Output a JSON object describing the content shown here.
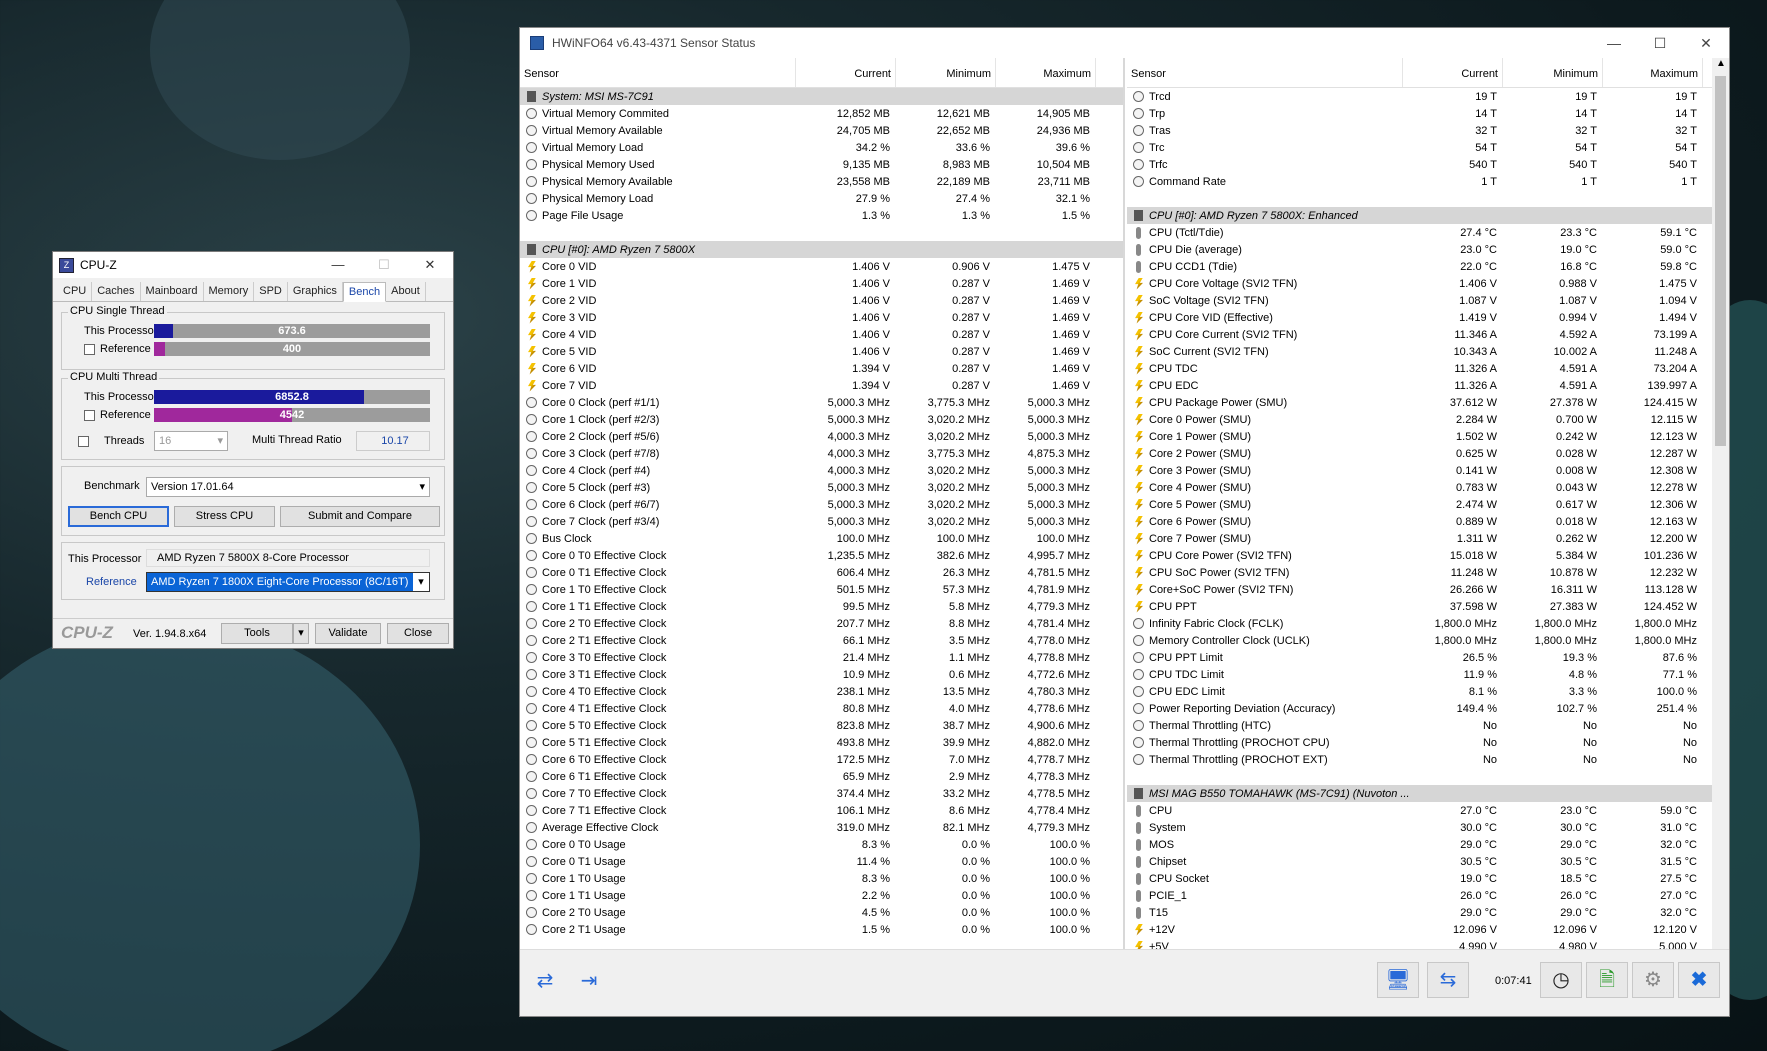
{
  "cpuz": {
    "title": "CPU-Z",
    "tabs": [
      "CPU",
      "Caches",
      "Mainboard",
      "Memory",
      "SPD",
      "Graphics",
      "Bench",
      "About"
    ],
    "active_tab": "Bench",
    "single_thread_label": "CPU Single Thread",
    "multi_thread_label": "CPU Multi Thread",
    "this_processor_label": "This Processor",
    "reference_label": "Reference",
    "single_this_value": "673.6",
    "single_this_fraction": 0.07,
    "single_ref_value": "400",
    "single_ref_fraction": 0.04,
    "multi_this_value": "6852.8",
    "multi_this_fraction": 0.76,
    "multi_ref_value": "4542",
    "multi_ref_fraction": 0.5,
    "threads_label": "Threads",
    "threads_value": "16",
    "mt_ratio_label": "Multi Thread Ratio",
    "mt_ratio_value": "10.17",
    "benchmark_label": "Benchmark",
    "benchmark_value": "Version 17.01.64",
    "bench_cpu": "Bench CPU",
    "stress_cpu": "Stress CPU",
    "submit": "Submit and Compare",
    "this_processor_name": "AMD Ryzen 7 5800X 8-Core Processor",
    "reference_name": "AMD Ryzen 7 1800X Eight-Core Processor (8C/16T)",
    "logo": "CPU-Z",
    "version": "Ver. 1.94.8.x64",
    "tools": "Tools",
    "validate": "Validate",
    "close": "Close",
    "colors": {
      "this_bar": "#1a1a9c",
      "ref_bar": "#a0289c"
    }
  },
  "hwinfo": {
    "title": "HWiNFO64 v6.43-4371 Sensor Status",
    "columns": [
      "Sensor",
      "Current",
      "Minimum",
      "Maximum"
    ],
    "time": "0:07:41",
    "left_rows": [
      {
        "t": "group",
        "n": "System: MSI MS-7C91"
      },
      {
        "t": "clock",
        "n": "Virtual Memory Commited",
        "c": "12,852 MB",
        "mi": "12,621 MB",
        "ma": "14,905 MB"
      },
      {
        "t": "clock",
        "n": "Virtual Memory Available",
        "c": "24,705 MB",
        "mi": "22,652 MB",
        "ma": "24,936 MB"
      },
      {
        "t": "clock",
        "n": "Virtual Memory Load",
        "c": "34.2 %",
        "mi": "33.6 %",
        "ma": "39.6 %"
      },
      {
        "t": "clock",
        "n": "Physical Memory Used",
        "c": "9,135 MB",
        "mi": "8,983 MB",
        "ma": "10,504 MB"
      },
      {
        "t": "clock",
        "n": "Physical Memory Available",
        "c": "23,558 MB",
        "mi": "22,189 MB",
        "ma": "23,711 MB"
      },
      {
        "t": "clock",
        "n": "Physical Memory Load",
        "c": "27.9 %",
        "mi": "27.4 %",
        "ma": "32.1 %"
      },
      {
        "t": "clock",
        "n": "Page File Usage",
        "c": "1.3 %",
        "mi": "1.3 %",
        "ma": "1.5 %"
      },
      {
        "t": "blank",
        "n": ""
      },
      {
        "t": "group",
        "n": "CPU [#0]: AMD Ryzen 7 5800X"
      },
      {
        "t": "volt",
        "n": "Core 0 VID",
        "c": "1.406 V",
        "mi": "0.906 V",
        "ma": "1.475 V"
      },
      {
        "t": "volt",
        "n": "Core 1 VID",
        "c": "1.406 V",
        "mi": "0.287 V",
        "ma": "1.469 V"
      },
      {
        "t": "volt",
        "n": "Core 2 VID",
        "c": "1.406 V",
        "mi": "0.287 V",
        "ma": "1.469 V"
      },
      {
        "t": "volt",
        "n": "Core 3 VID",
        "c": "1.406 V",
        "mi": "0.287 V",
        "ma": "1.469 V"
      },
      {
        "t": "volt",
        "n": "Core 4 VID",
        "c": "1.406 V",
        "mi": "0.287 V",
        "ma": "1.469 V"
      },
      {
        "t": "volt",
        "n": "Core 5 VID",
        "c": "1.406 V",
        "mi": "0.287 V",
        "ma": "1.469 V"
      },
      {
        "t": "volt",
        "n": "Core 6 VID",
        "c": "1.394 V",
        "mi": "0.287 V",
        "ma": "1.469 V"
      },
      {
        "t": "volt",
        "n": "Core 7 VID",
        "c": "1.394 V",
        "mi": "0.287 V",
        "ma": "1.469 V"
      },
      {
        "t": "clock",
        "n": "Core 0 Clock (perf #1/1)",
        "c": "5,000.3 MHz",
        "mi": "3,775.3 MHz",
        "ma": "5,000.3 MHz"
      },
      {
        "t": "clock",
        "n": "Core 1 Clock (perf #2/3)",
        "c": "5,000.3 MHz",
        "mi": "3,020.2 MHz",
        "ma": "5,000.3 MHz"
      },
      {
        "t": "clock",
        "n": "Core 2 Clock (perf #5/6)",
        "c": "4,000.3 MHz",
        "mi": "3,020.2 MHz",
        "ma": "5,000.3 MHz"
      },
      {
        "t": "clock",
        "n": "Core 3 Clock (perf #7/8)",
        "c": "4,000.3 MHz",
        "mi": "3,775.3 MHz",
        "ma": "4,875.3 MHz"
      },
      {
        "t": "clock",
        "n": "Core 4 Clock (perf #4)",
        "c": "4,000.3 MHz",
        "mi": "3,020.2 MHz",
        "ma": "5,000.3 MHz"
      },
      {
        "t": "clock",
        "n": "Core 5 Clock (perf #3)",
        "c": "5,000.3 MHz",
        "mi": "3,020.2 MHz",
        "ma": "5,000.3 MHz"
      },
      {
        "t": "clock",
        "n": "Core 6 Clock (perf #6/7)",
        "c": "5,000.3 MHz",
        "mi": "3,020.2 MHz",
        "ma": "5,000.3 MHz"
      },
      {
        "t": "clock",
        "n": "Core 7 Clock (perf #3/4)",
        "c": "5,000.3 MHz",
        "mi": "3,020.2 MHz",
        "ma": "5,000.3 MHz"
      },
      {
        "t": "clock",
        "n": "Bus Clock",
        "c": "100.0 MHz",
        "mi": "100.0 MHz",
        "ma": "100.0 MHz"
      },
      {
        "t": "clock",
        "n": "Core 0 T0 Effective Clock",
        "c": "1,235.5 MHz",
        "mi": "382.6 MHz",
        "ma": "4,995.7 MHz"
      },
      {
        "t": "clock",
        "n": "Core 0 T1 Effective Clock",
        "c": "606.4 MHz",
        "mi": "26.3 MHz",
        "ma": "4,781.5 MHz"
      },
      {
        "t": "clock",
        "n": "Core 1 T0 Effective Clock",
        "c": "501.5 MHz",
        "mi": "57.3 MHz",
        "ma": "4,781.9 MHz"
      },
      {
        "t": "clock",
        "n": "Core 1 T1 Effective Clock",
        "c": "99.5 MHz",
        "mi": "5.8 MHz",
        "ma": "4,779.3 MHz"
      },
      {
        "t": "clock",
        "n": "Core 2 T0 Effective Clock",
        "c": "207.7 MHz",
        "mi": "8.8 MHz",
        "ma": "4,781.4 MHz"
      },
      {
        "t": "clock",
        "n": "Core 2 T1 Effective Clock",
        "c": "66.1 MHz",
        "mi": "3.5 MHz",
        "ma": "4,778.0 MHz"
      },
      {
        "t": "clock",
        "n": "Core 3 T0 Effective Clock",
        "c": "21.4 MHz",
        "mi": "1.1 MHz",
        "ma": "4,778.8 MHz"
      },
      {
        "t": "clock",
        "n": "Core 3 T1 Effective Clock",
        "c": "10.9 MHz",
        "mi": "0.6 MHz",
        "ma": "4,772.6 MHz"
      },
      {
        "t": "clock",
        "n": "Core 4 T0 Effective Clock",
        "c": "238.1 MHz",
        "mi": "13.5 MHz",
        "ma": "4,780.3 MHz"
      },
      {
        "t": "clock",
        "n": "Core 4 T1 Effective Clock",
        "c": "80.8 MHz",
        "mi": "4.0 MHz",
        "ma": "4,778.6 MHz"
      },
      {
        "t": "clock",
        "n": "Core 5 T0 Effective Clock",
        "c": "823.8 MHz",
        "mi": "38.7 MHz",
        "ma": "4,900.6 MHz"
      },
      {
        "t": "clock",
        "n": "Core 5 T1 Effective Clock",
        "c": "493.8 MHz",
        "mi": "39.9 MHz",
        "ma": "4,882.0 MHz"
      },
      {
        "t": "clock",
        "n": "Core 6 T0 Effective Clock",
        "c": "172.5 MHz",
        "mi": "7.0 MHz",
        "ma": "4,778.7 MHz"
      },
      {
        "t": "clock",
        "n": "Core 6 T1 Effective Clock",
        "c": "65.9 MHz",
        "mi": "2.9 MHz",
        "ma": "4,778.3 MHz"
      },
      {
        "t": "clock",
        "n": "Core 7 T0 Effective Clock",
        "c": "374.4 MHz",
        "mi": "33.2 MHz",
        "ma": "4,778.5 MHz"
      },
      {
        "t": "clock",
        "n": "Core 7 T1 Effective Clock",
        "c": "106.1 MHz",
        "mi": "8.6 MHz",
        "ma": "4,778.4 MHz"
      },
      {
        "t": "clock",
        "n": "Average Effective Clock",
        "c": "319.0 MHz",
        "mi": "82.1 MHz",
        "ma": "4,779.3 MHz"
      },
      {
        "t": "clock",
        "n": "Core 0 T0 Usage",
        "c": "8.3 %",
        "mi": "0.0 %",
        "ma": "100.0 %"
      },
      {
        "t": "clock",
        "n": "Core 0 T1 Usage",
        "c": "11.4 %",
        "mi": "0.0 %",
        "ma": "100.0 %"
      },
      {
        "t": "clock",
        "n": "Core 1 T0 Usage",
        "c": "8.3 %",
        "mi": "0.0 %",
        "ma": "100.0 %"
      },
      {
        "t": "clock",
        "n": "Core 1 T1 Usage",
        "c": "2.2 %",
        "mi": "0.0 %",
        "ma": "100.0 %"
      },
      {
        "t": "clock",
        "n": "Core 2 T0 Usage",
        "c": "4.5 %",
        "mi": "0.0 %",
        "ma": "100.0 %"
      },
      {
        "t": "clock",
        "n": "Core 2 T1 Usage",
        "c": "1.5 %",
        "mi": "0.0 %",
        "ma": "100.0 %"
      }
    ],
    "right_rows": [
      {
        "t": "clock",
        "n": "Trcd",
        "c": "19 T",
        "mi": "19 T",
        "ma": "19 T"
      },
      {
        "t": "clock",
        "n": "Trp",
        "c": "14 T",
        "mi": "14 T",
        "ma": "14 T"
      },
      {
        "t": "clock",
        "n": "Tras",
        "c": "32 T",
        "mi": "32 T",
        "ma": "32 T"
      },
      {
        "t": "clock",
        "n": "Trc",
        "c": "54 T",
        "mi": "54 T",
        "ma": "54 T"
      },
      {
        "t": "clock",
        "n": "Trfc",
        "c": "540 T",
        "mi": "540 T",
        "ma": "540 T"
      },
      {
        "t": "clock",
        "n": "Command Rate",
        "c": "1 T",
        "mi": "1 T",
        "ma": "1 T"
      },
      {
        "t": "blank",
        "n": ""
      },
      {
        "t": "group",
        "n": "CPU [#0]: AMD Ryzen 7 5800X: Enhanced"
      },
      {
        "t": "temp",
        "n": "CPU (Tctl/Tdie)",
        "c": "27.4 °C",
        "mi": "23.3 °C",
        "ma": "59.1 °C"
      },
      {
        "t": "temp",
        "n": "CPU Die (average)",
        "c": "23.0 °C",
        "mi": "19.0 °C",
        "ma": "59.0 °C"
      },
      {
        "t": "temp",
        "n": "CPU CCD1 (Tdie)",
        "c": "22.0 °C",
        "mi": "16.8 °C",
        "ma": "59.8 °C"
      },
      {
        "t": "volt",
        "n": "CPU Core Voltage (SVI2 TFN)",
        "c": "1.406 V",
        "mi": "0.988 V",
        "ma": "1.475 V"
      },
      {
        "t": "volt",
        "n": "SoC Voltage (SVI2 TFN)",
        "c": "1.087 V",
        "mi": "1.087 V",
        "ma": "1.094 V"
      },
      {
        "t": "volt",
        "n": "CPU Core VID (Effective)",
        "c": "1.419 V",
        "mi": "0.994 V",
        "ma": "1.494 V"
      },
      {
        "t": "volt",
        "n": "CPU Core Current (SVI2 TFN)",
        "c": "11.346 A",
        "mi": "4.592 A",
        "ma": "73.199 A"
      },
      {
        "t": "volt",
        "n": "SoC Current (SVI2 TFN)",
        "c": "10.343 A",
        "mi": "10.002 A",
        "ma": "11.248 A"
      },
      {
        "t": "volt",
        "n": "CPU TDC",
        "c": "11.326 A",
        "mi": "4.591 A",
        "ma": "73.204 A"
      },
      {
        "t": "volt",
        "n": "CPU EDC",
        "c": "11.326 A",
        "mi": "4.591 A",
        "ma": "139.997 A"
      },
      {
        "t": "volt",
        "n": "CPU Package Power (SMU)",
        "c": "37.612 W",
        "mi": "27.378 W",
        "ma": "124.415 W"
      },
      {
        "t": "volt",
        "n": "Core 0 Power (SMU)",
        "c": "2.284 W",
        "mi": "0.700 W",
        "ma": "12.115 W"
      },
      {
        "t": "volt",
        "n": "Core 1 Power (SMU)",
        "c": "1.502 W",
        "mi": "0.242 W",
        "ma": "12.123 W"
      },
      {
        "t": "volt",
        "n": "Core 2 Power (SMU)",
        "c": "0.625 W",
        "mi": "0.028 W",
        "ma": "12.287 W"
      },
      {
        "t": "volt",
        "n": "Core 3 Power (SMU)",
        "c": "0.141 W",
        "mi": "0.008 W",
        "ma": "12.308 W"
      },
      {
        "t": "volt",
        "n": "Core 4 Power (SMU)",
        "c": "0.783 W",
        "mi": "0.043 W",
        "ma": "12.278 W"
      },
      {
        "t": "volt",
        "n": "Core 5 Power (SMU)",
        "c": "2.474 W",
        "mi": "0.617 W",
        "ma": "12.306 W"
      },
      {
        "t": "volt",
        "n": "Core 6 Power (SMU)",
        "c": "0.889 W",
        "mi": "0.018 W",
        "ma": "12.163 W"
      },
      {
        "t": "volt",
        "n": "Core 7 Power (SMU)",
        "c": "1.311 W",
        "mi": "0.262 W",
        "ma": "12.200 W"
      },
      {
        "t": "volt",
        "n": "CPU Core Power (SVI2 TFN)",
        "c": "15.018 W",
        "mi": "5.384 W",
        "ma": "101.236 W"
      },
      {
        "t": "volt",
        "n": "CPU SoC Power (SVI2 TFN)",
        "c": "11.248 W",
        "mi": "10.878 W",
        "ma": "12.232 W"
      },
      {
        "t": "volt",
        "n": "Core+SoC Power (SVI2 TFN)",
        "c": "26.266 W",
        "mi": "16.311 W",
        "ma": "113.128 W"
      },
      {
        "t": "volt",
        "n": "CPU PPT",
        "c": "37.598 W",
        "mi": "27.383 W",
        "ma": "124.452 W"
      },
      {
        "t": "clock",
        "n": "Infinity Fabric Clock (FCLK)",
        "c": "1,800.0 MHz",
        "mi": "1,800.0 MHz",
        "ma": "1,800.0 MHz"
      },
      {
        "t": "clock",
        "n": "Memory Controller Clock (UCLK)",
        "c": "1,800.0 MHz",
        "mi": "1,800.0 MHz",
        "ma": "1,800.0 MHz"
      },
      {
        "t": "clock",
        "n": "CPU PPT Limit",
        "c": "26.5 %",
        "mi": "19.3 %",
        "ma": "87.6 %"
      },
      {
        "t": "clock",
        "n": "CPU TDC Limit",
        "c": "11.9 %",
        "mi": "4.8 %",
        "ma": "77.1 %"
      },
      {
        "t": "clock",
        "n": "CPU EDC Limit",
        "c": "8.1 %",
        "mi": "3.3 %",
        "ma": "100.0 %"
      },
      {
        "t": "clock",
        "n": "Power Reporting Deviation (Accuracy)",
        "c": "149.4 %",
        "mi": "102.7 %",
        "ma": "251.4 %"
      },
      {
        "t": "clock",
        "n": "Thermal Throttling (HTC)",
        "c": "No",
        "mi": "No",
        "ma": "No"
      },
      {
        "t": "clock",
        "n": "Thermal Throttling (PROCHOT CPU)",
        "c": "No",
        "mi": "No",
        "ma": "No"
      },
      {
        "t": "clock",
        "n": "Thermal Throttling (PROCHOT EXT)",
        "c": "No",
        "mi": "No",
        "ma": "No"
      },
      {
        "t": "blank",
        "n": ""
      },
      {
        "t": "group",
        "n": "MSI MAG B550 TOMAHAWK (MS-7C91) (Nuvoton ..."
      },
      {
        "t": "temp",
        "n": "CPU",
        "c": "27.0 °C",
        "mi": "23.0 °C",
        "ma": "59.0 °C"
      },
      {
        "t": "temp",
        "n": "System",
        "c": "30.0 °C",
        "mi": "30.0 °C",
        "ma": "31.0 °C"
      },
      {
        "t": "temp",
        "n": "MOS",
        "c": "29.0 °C",
        "mi": "29.0 °C",
        "ma": "32.0 °C"
      },
      {
        "t": "temp",
        "n": "Chipset",
        "c": "30.5 °C",
        "mi": "30.5 °C",
        "ma": "31.5 °C"
      },
      {
        "t": "temp",
        "n": "CPU Socket",
        "c": "19.0 °C",
        "mi": "18.5 °C",
        "ma": "27.5 °C"
      },
      {
        "t": "temp",
        "n": "PCIE_1",
        "c": "26.0 °C",
        "mi": "26.0 °C",
        "ma": "27.0 °C"
      },
      {
        "t": "temp",
        "n": "T15",
        "c": "29.0 °C",
        "mi": "29.0 °C",
        "ma": "32.0 °C"
      },
      {
        "t": "volt",
        "n": "+12V",
        "c": "12.096 V",
        "mi": "12.096 V",
        "ma": "12.120 V"
      },
      {
        "t": "volt",
        "n": "+5V",
        "c": "4.990 V",
        "mi": "4.980 V",
        "ma": "5.000 V"
      }
    ]
  }
}
